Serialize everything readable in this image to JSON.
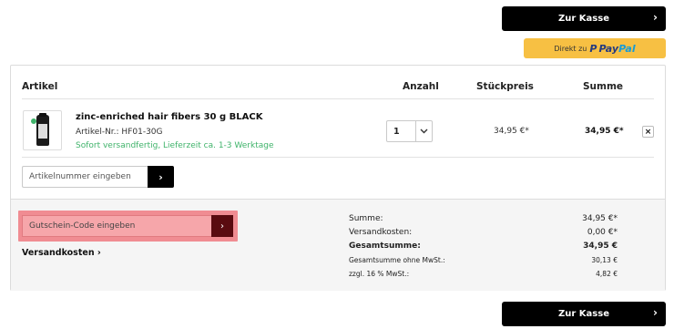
{
  "checkout": {
    "label": "Zur Kasse",
    "chevron": "›"
  },
  "paypal": {
    "prefix": "Direkt zu",
    "mark": "P",
    "brand_pay": "Pay",
    "brand_pal": "Pal"
  },
  "table": {
    "headers": {
      "artikel": "Artikel",
      "anzahl": "Anzahl",
      "stueckpreis": "Stückpreis",
      "summe": "Summe"
    }
  },
  "item": {
    "name": "zinc-enriched hair fibers 30 g BLACK",
    "article_number": "Artikel-Nr.: HF01-30G",
    "shipping": "Sofort versandfertig, Lieferzeit ca. 1-3 Werktage",
    "quantity": "1",
    "unit_price": "34,95 €*",
    "total": "34,95 €*",
    "remove_icon": "×"
  },
  "article_input": {
    "placeholder": "Artikelnummer eingeben",
    "button": "›"
  },
  "voucher": {
    "placeholder": "Gutschein-Code eingeben",
    "button": "›"
  },
  "shipping_costs_link": "Versandkosten ›",
  "summary": {
    "summe_label": "Summe:",
    "summe_value": "34,95 €*",
    "versand_label": "Versandkosten:",
    "versand_value": "0,00 €*",
    "gesamt_label": "Gesamtsumme:",
    "gesamt_value": "34,95 €",
    "netto_label": "Gesamtsumme ohne MwSt.:",
    "netto_value": "30,13 €",
    "mwst_label": "zzgl. 16 % MwSt.:",
    "mwst_value": "4,82 €"
  },
  "colors": {
    "accent_green": "#3fb36a",
    "paypal_yellow": "#f7c043",
    "highlight": "#f08c92"
  }
}
